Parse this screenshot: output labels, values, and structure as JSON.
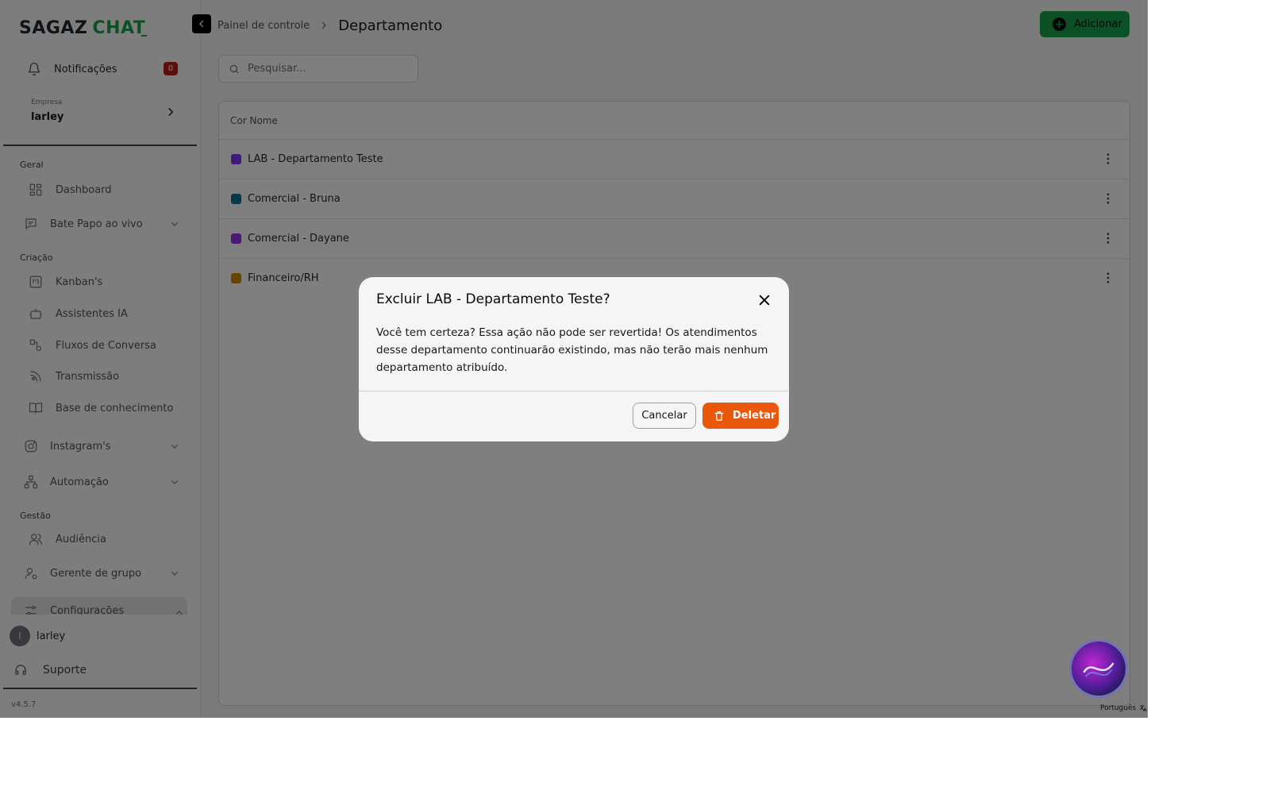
{
  "brand": {
    "part1": "SAGAZ",
    "part2": "CHAT"
  },
  "sidebar": {
    "notifications": {
      "label": "Notificações",
      "count": "0"
    },
    "company": {
      "caption": "Empresa",
      "name": "larley"
    },
    "sections": {
      "general": "Geral",
      "creation": "Criação",
      "management": "Gestão"
    },
    "items": {
      "dashboard": "Dashboard",
      "live_chat": "Bate Papo ao vivo",
      "kanbans": "Kanban's",
      "ai_assistants": "Assistentes IA",
      "flows": "Fluxos de Conversa",
      "broadcast": "Transmissão",
      "knowledge": "Base de conhecimento",
      "instagram": "Instagram's",
      "automation": "Automação",
      "audience": "Audiência",
      "group_manager": "Gerente de grupo",
      "settings": "Configurações"
    },
    "user": {
      "initial": "l",
      "name": "larley"
    },
    "support": "Suporte",
    "version": "v4.5.7"
  },
  "header": {
    "breadcrumb_parent": "Painel de controle",
    "breadcrumb_current": "Departamento",
    "add_label": "Adicionar"
  },
  "search": {
    "placeholder": "Pesquisar..."
  },
  "table": {
    "header": "Cor Nome",
    "rows": [
      {
        "name": "LAB - Departamento Teste",
        "color": "#7c3aed"
      },
      {
        "name": "Comercial - Bruna",
        "color": "#0e7490"
      },
      {
        "name": "Comercial - Dayane",
        "color": "#9333ea"
      },
      {
        "name": "Financeiro/RH",
        "color": "#ca8a04"
      }
    ]
  },
  "dialog": {
    "title": "Excluir LAB - Departamento Teste?",
    "body": "Você tem certeza? Essa ação não pode ser revertida! Os atendimentos desse departamento continuarão existindo, mas não terão mais nenhum departamento atribuído.",
    "cancel": "Cancelar",
    "delete": "Deletar"
  },
  "language": "Português",
  "colors": {
    "accent_green": "#16a34a",
    "danger_orange": "#ea580c",
    "badge_red": "#b91c1c"
  }
}
